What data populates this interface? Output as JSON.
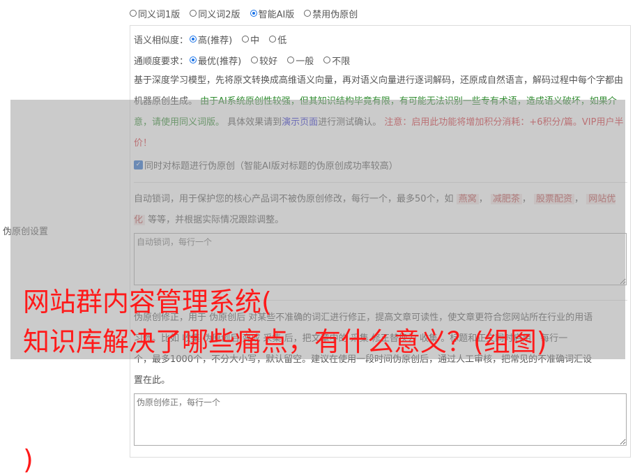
{
  "modes": [
    {
      "label": "同义词1版",
      "checked": false
    },
    {
      "label": "同义词2版",
      "checked": false
    },
    {
      "label": "智能AI版",
      "checked": true
    },
    {
      "label": "禁用伪原创",
      "checked": false
    }
  ],
  "side_label": "伪原创设置",
  "similarity": {
    "label": "语义相似度：",
    "options": [
      {
        "label": "高(推荐)",
        "checked": true
      },
      {
        "label": "中",
        "checked": false
      },
      {
        "label": "低",
        "checked": false
      }
    ]
  },
  "fluency": {
    "label": "通顺度要求：",
    "options": [
      {
        "label": "最优(推荐)",
        "checked": true
      },
      {
        "label": "较好",
        "checked": false
      },
      {
        "label": "一般",
        "checked": false
      },
      {
        "label": "不限",
        "checked": false
      }
    ]
  },
  "description": {
    "p1": "基于深度学习模型，先将原文转换成高维语义向量，再对语义向量进行逐词解码，还原成自然语言，解码过程中每个字都由机器原创生成。",
    "p2": "由于AI系统原创性较强，但其知识结构毕竟有限，有可能无法识别一些专有术语，造成语义破坏，如果介意，请使用同义词版。",
    "p3a": "具体效果请到",
    "p3_link": "演示页面",
    "p3b": "进行测试确认。",
    "p4": "注意：启用此功能将增加积分消耗：+6积分/篇。VIP用户半价！"
  },
  "title_checkbox": {
    "label": "同时对标题进行伪原创（智能AI版对标题的伪原创成功率较高）",
    "checked": true
  },
  "lock": {
    "desc_a": "自动锁词，用于保护您的核心产品词不被伪原创修改，每行一个，最多50个，如",
    "tags": [
      "燕窝",
      "减肥茶",
      "股票配资",
      "网站优化"
    ],
    "sep": "，",
    "desc_b": "等等，并根据实际情况跟踪调整。",
    "placeholder": "自动锁词，每行一个"
  },
  "correction": {
    "line1": "伪原创修正，用于 伪原创后 对某些不准确的词汇进行修正，提高文章可读性，使文章更符合您网站所在行业的用语",
    "line2": "习惯。比如 收集 伪原创后 变成 采集 后，把文章中的 采集 修正替换为 收集 。标题和正文同时启用，每行一",
    "line3": "个，最多1000个，不分大小写，默认留空。建议在使用一段时间伪原创后，通过人工审核，把常见的不准确词汇设",
    "line4": "置在此。",
    "placeholder": "伪原创修正，每行一个"
  },
  "banner": {
    "line1": "网站群内容管理系统(",
    "line2": "知识库解决了哪些痛点，有什么意义？(组图)",
    "line3": ")"
  }
}
